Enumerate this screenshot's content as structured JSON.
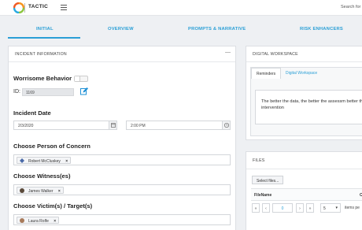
{
  "app": {
    "brand": "TACTIC",
    "search_text": "Search for"
  },
  "tabs": [
    {
      "label": "INITIAL",
      "active": true
    },
    {
      "label": "OVERVIEW",
      "active": false
    },
    {
      "label": "PROMPTS & NARRATIVE",
      "active": false
    },
    {
      "label": "RISK ENHANCERS",
      "active": false
    }
  ],
  "incident": {
    "panel_title": "INCIDENT INFORMATION",
    "panel_menu": "—",
    "worrisome_label": "Worrisome Behavior",
    "worrisome_on": false,
    "id_label": "ID:",
    "id_value": "1169",
    "incident_date_label": "Incident Date",
    "date_value": "2/3/2020",
    "time_value": "2:00 PM",
    "person_label": "Choose Person of Concern",
    "person_tag": "Robert McCluskey",
    "witness_label": "Choose Witness(es)",
    "witness_tag": "James Walker",
    "victim_label": "Choose Victim(s) / Target(s)",
    "victim_tag": "Laura Rolfe",
    "tag_remove": "×"
  },
  "workspace": {
    "panel_title": "DIGITAL WORKSPACE",
    "subtabs": [
      "Reminders",
      "Digital Workspace"
    ],
    "reminder_text": "The better the data, the better the assessm better the intervention"
  },
  "files": {
    "panel_title": "FILES",
    "select_button": "Select files...",
    "column_header": "FileName",
    "column_header_2": "C",
    "pager": {
      "first": "«",
      "prev": "‹",
      "page": "0",
      "next": "›",
      "last": "»",
      "page_size": "5",
      "page_size_caret": "▾",
      "per_page_label": "items pe"
    }
  },
  "colors": {
    "accent": "#2a9fd6",
    "logo_orange": "#f7941d",
    "logo_green": "#8cc63f",
    "logo_blue": "#29abe2",
    "edit_icon": "#1e90d6"
  }
}
